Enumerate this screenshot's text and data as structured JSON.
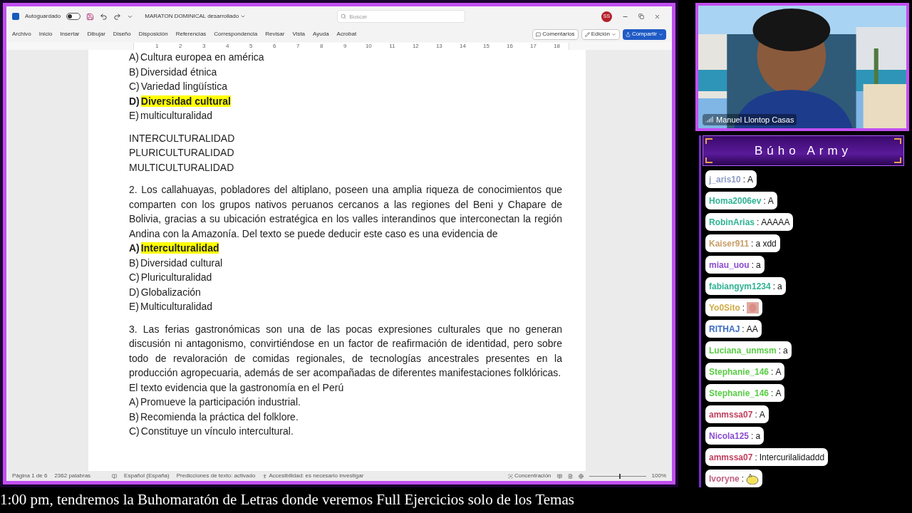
{
  "word": {
    "autosave": {
      "label": "Autoguardado",
      "on": false
    },
    "title": "MARATON DOMINICAL desarrollado",
    "search": {
      "placeholder": "Buscar"
    },
    "user_initials": "SS",
    "menu": [
      "Archivo",
      "Inicio",
      "Insertar",
      "Dibujar",
      "Diseño",
      "Disposición",
      "Referencias",
      "Correspondencia",
      "Revisar",
      "Vista",
      "Ayuda",
      "Acrobat"
    ],
    "actions": [
      {
        "label": "Comentarios",
        "kind": "comments"
      },
      {
        "label": "Edición",
        "kind": "editing"
      },
      {
        "label": "Compartir",
        "kind": "share"
      }
    ],
    "ruler": [
      "1",
      "2",
      "3",
      "4",
      "5",
      "6",
      "7",
      "8",
      "9",
      "10",
      "11",
      "12",
      "13",
      "14",
      "15",
      "16",
      "17",
      "18"
    ],
    "document": [
      [
        {
          "kind": "option",
          "letter": "A)",
          "text": "Cultura europea en américa",
          "highlighted": false
        },
        {
          "kind": "option",
          "letter": "B)",
          "text": "Diversidad étnica",
          "highlighted": false
        },
        {
          "kind": "option",
          "letter": "C)",
          "text": "Variedad lingüística",
          "highlighted": false
        },
        {
          "kind": "option",
          "letter": "D)",
          "text": "Diversidad cultural",
          "highlighted": true
        },
        {
          "kind": "option",
          "letter": "E)",
          "text": "multiculturalidad",
          "highlighted": false
        }
      ],
      [
        {
          "kind": "line",
          "text": "INTERCULTURALIDAD"
        },
        {
          "kind": "line",
          "text": "PLURICULTURALIDAD"
        },
        {
          "kind": "line",
          "text": "MULTICULTURALIDAD"
        }
      ],
      [
        {
          "kind": "paragraph",
          "text": "2. Los callahuayas, pobladores del altiplano, poseen una amplia riqueza de conocimientos que comparten con los grupos nativos peruanos cercanos a las regiones del Beni y Chapare de Bolivia, gracias a su ubicación estratégica en los valles interandinos que interconectan la región Andina con la Amazonía. Del texto se puede deducir este caso es una evidencia de"
        },
        {
          "kind": "option",
          "letter": "A)",
          "text": "Interculturalidad",
          "highlighted": true
        },
        {
          "kind": "option",
          "letter": "B)",
          "text": "Diversidad cultural",
          "highlighted": false
        },
        {
          "kind": "option",
          "letter": "C)",
          "text": "Pluriculturalidad",
          "highlighted": false
        },
        {
          "kind": "option",
          "letter": "D)",
          "text": "Globalización",
          "highlighted": false
        },
        {
          "kind": "option",
          "letter": "E)",
          "text": "Multiculturalidad",
          "highlighted": false
        }
      ],
      [
        {
          "kind": "paragraph",
          "text": "3. Las ferias gastronómicas son una de las pocas expresiones culturales que no generan discusión ni antagonismo, convirtiéndose en un factor de reafirmación de identidad, pero sobre todo de revaloración de comidas regionales, de tecnologías ancestrales presentes en la producción agropecuaria, además de ser acompañadas de diferentes manifestaciones folklóricas."
        },
        {
          "kind": "line",
          "text": "El texto evidencia que la gastronomía en el Perú"
        },
        {
          "kind": "option",
          "letter": "A)",
          "text": "Promueve la participación industrial.",
          "highlighted": false
        },
        {
          "kind": "option",
          "letter": "B)",
          "text": "Recomienda la práctica del folklore.",
          "highlighted": false
        },
        {
          "kind": "option",
          "letter": "C)",
          "text": "Constituye un vínculo intercultural.",
          "highlighted": false
        }
      ]
    ],
    "status_bar": {
      "page": "Página 1 de 6",
      "words": "2362 palabras",
      "language": "Español (España)",
      "predictions": "Predicciones de texto: activado",
      "accessibility": "Accesibilidad: es necesario investigar",
      "focus": "Concentración",
      "zoom": {
        "level": 0.55
      },
      "zoom_label": "100%"
    }
  },
  "webcam": {
    "name": "Manuel Llontop Casas"
  },
  "chat": {
    "title": "Búho Army",
    "separator": ":",
    "messages": [
      {
        "user": "j_aris10",
        "color": "#8c9cc4",
        "kind": "text",
        "text": "A"
      },
      {
        "user": "Homa2006ev",
        "color": "#2fb394",
        "kind": "text",
        "text": "A"
      },
      {
        "user": "RobinArias",
        "color": "#2fb394",
        "kind": "text",
        "text": "AAAAA"
      },
      {
        "user": "Kaiser911",
        "color": "#c8a06a",
        "kind": "text",
        "text": "a xdd"
      },
      {
        "user": "miau_uou",
        "color": "#8a4cd0",
        "kind": "text",
        "text": "a"
      },
      {
        "user": "fabiangym1234",
        "color": "#2fb394",
        "kind": "text",
        "text": "a"
      },
      {
        "user": "Yo0Sito",
        "color": "#d0ac48",
        "kind": "emote"
      },
      {
        "user": "RITHAJ",
        "color": "#3a6cc4",
        "kind": "text",
        "text": "AA"
      },
      {
        "user": "Luciana_unmsm",
        "color": "#58cc44",
        "kind": "text",
        "text": "a"
      },
      {
        "user": "Stephanie_146",
        "color": "#58cc44",
        "kind": "text",
        "text": "A"
      },
      {
        "user": "Stephanie_146",
        "color": "#58cc44",
        "kind": "text",
        "text": "A"
      },
      {
        "user": "ammssa07",
        "color": "#c03e5c",
        "kind": "text",
        "text": "A"
      },
      {
        "user": "Nicola125",
        "color": "#8a4cd0",
        "kind": "text",
        "text": "a"
      },
      {
        "user": "ammssa07",
        "color": "#c03e5c",
        "kind": "text",
        "text": "Intercurilalidaddd"
      },
      {
        "user": "Ivoryne",
        "color": "#c0607e",
        "kind": "sticker"
      }
    ]
  },
  "ticker": "1:00 pm, tendremos la Buhomaratón de Letras donde veremos Full Ejercicios solo de los Temas"
}
